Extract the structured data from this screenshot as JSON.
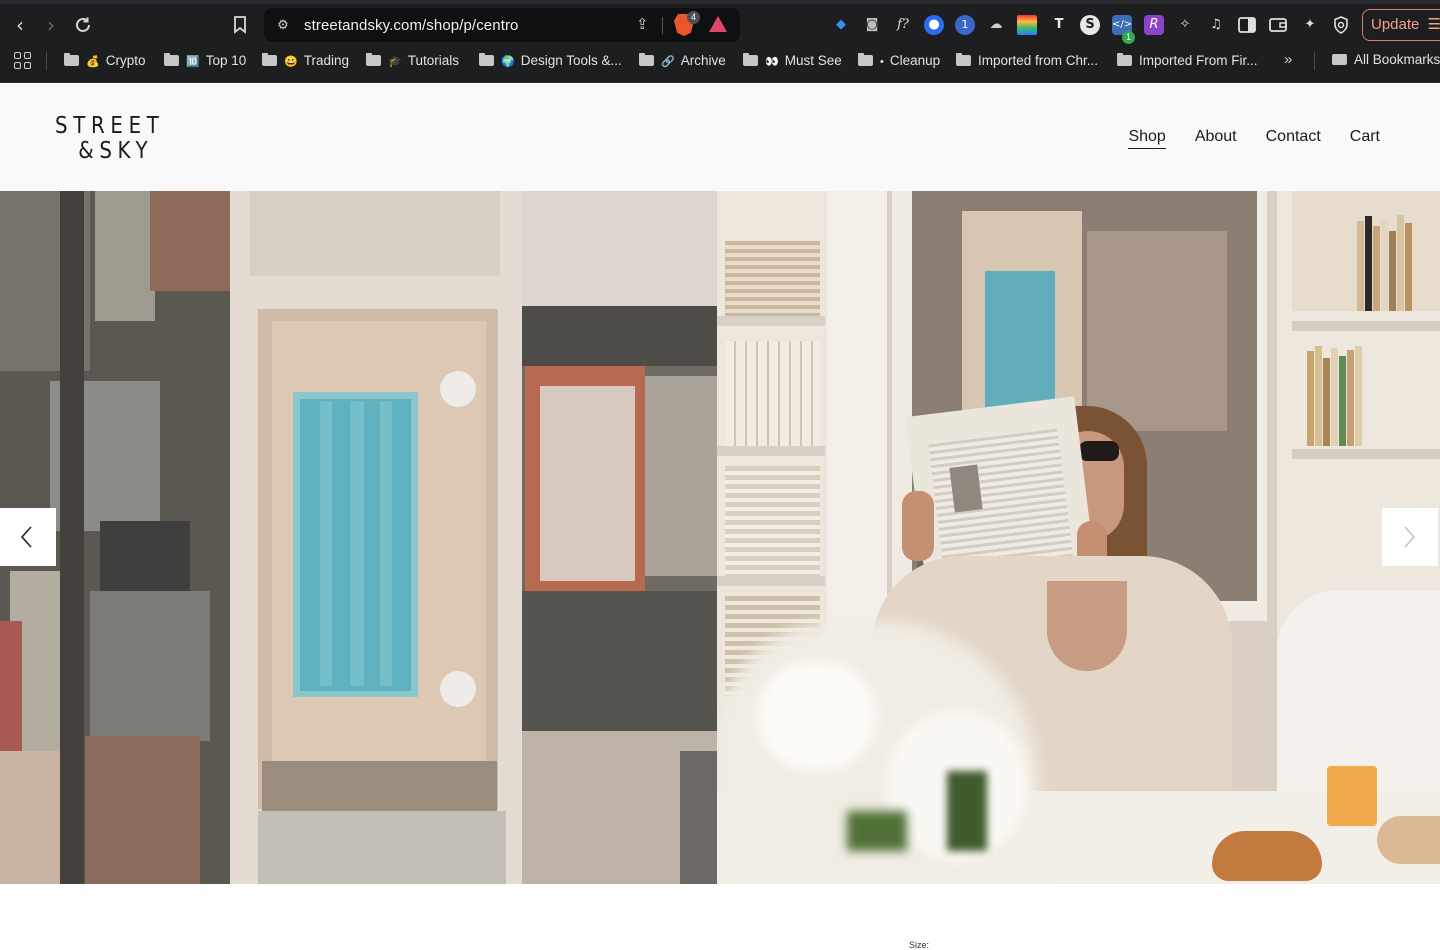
{
  "browser": {
    "url": "streetandsky.com/shop/p/centro",
    "brave_shield_count": "4",
    "extension_badge": "1",
    "update_label": "Update",
    "bookmarks": [
      {
        "label": "Crypto",
        "emoji": "💰"
      },
      {
        "label": "Top 10",
        "emoji": "🔟"
      },
      {
        "label": "Trading",
        "emoji": "😀"
      },
      {
        "label": "Tutorials",
        "emoji": "🎓"
      },
      {
        "label": "Design Tools &...",
        "emoji": "🌍"
      },
      {
        "label": "Archive",
        "emoji": "🔗"
      },
      {
        "label": "Must See",
        "emoji": "👀"
      },
      {
        "label": "Cleanup",
        "emoji": "•"
      },
      {
        "label": "Imported from Chr...",
        "emoji": ""
      },
      {
        "label": "Imported From Fir...",
        "emoji": ""
      }
    ],
    "bookmarks_overflow": "»",
    "all_bookmarks": "All Bookmarks"
  },
  "site": {
    "logo_line1": "STREET",
    "logo_line2": "&SKY",
    "nav": [
      {
        "label": "Shop",
        "active": true
      },
      {
        "label": "About",
        "active": false
      },
      {
        "label": "Contact",
        "active": false
      },
      {
        "label": "Cart",
        "active": false
      }
    ]
  },
  "product": {
    "size_label": "Size:"
  },
  "colors": {
    "chrome_bg": "#1d1e20",
    "header_bg": "#f9f9f9",
    "pool": "#5fb1c0",
    "update_accent": "#e07a5f"
  }
}
